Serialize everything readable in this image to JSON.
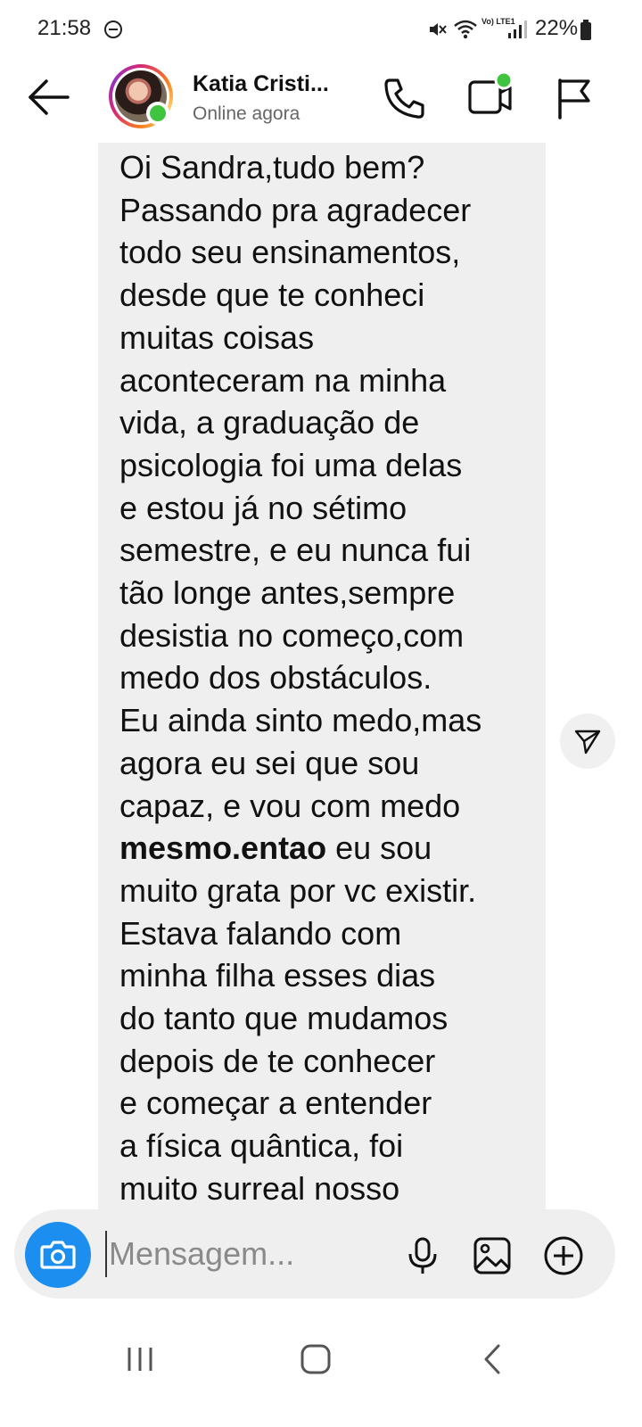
{
  "status_bar": {
    "time": "21:58",
    "network": "Vo) LTE1",
    "battery": "22%"
  },
  "header": {
    "back_icon": "arrow-left-icon",
    "contact_name": "Katia Cristi...",
    "contact_status": "Online agora",
    "online_color": "#3fc43f",
    "actions": [
      "phone-icon",
      "video-camera-icon",
      "flag-icon"
    ]
  },
  "message": {
    "lines_before_bold": "Oi Sandra,tudo bem?\nPassando pra agradecer\ntodo seu ensinamentos,\ndesde que te conheci\nmuitas coisas\naconteceram na minha\nvida, a graduação de\npsicologia foi uma delas\ne estou já no sétimo\nsemestre, e eu nunca fui\ntão longe antes,sempre\ndesistia no começo,com\nmedo dos obstáculos.\nEu ainda sinto medo,mas\nagora eu sei que sou\ncapaz, e vou com medo\n",
    "bold": "mesmo.entao",
    "lines_after_bold": " eu sou\nmuito grata por vc existir.\nEstava falando com\nminha filha esses dias\ndo tanto que mudamos\ndepois de te conhecer\ne começar a entender\na física quântica, foi\nmuito surreal nosso",
    "bubble_color": "#efefef"
  },
  "composer": {
    "placeholder": "Mensagem...",
    "camera_color": "#1b8ef0",
    "icons": [
      "camera-icon",
      "microphone-icon",
      "image-icon",
      "plus-circle-icon"
    ]
  },
  "nav_bar": {
    "icons": [
      "recents-icon",
      "home-icon",
      "back-chevron-icon"
    ]
  }
}
